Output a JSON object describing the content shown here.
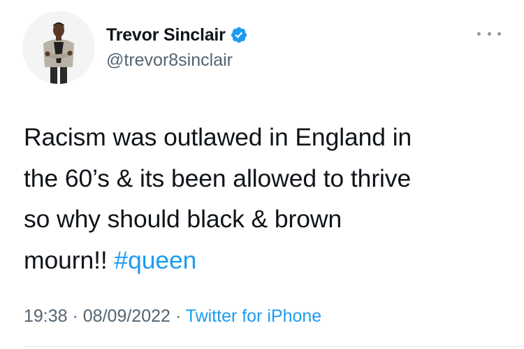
{
  "author": {
    "display_name": "Trevor Sinclair",
    "handle": "@trevor8sinclair",
    "verified": true,
    "verified_icon": "verified-badge-icon"
  },
  "tweet": {
    "lines": [
      "Racism was outlawed in England in",
      "the 60’s & its been allowed to thrive",
      "so why should black & brown",
      "mourn!! "
    ],
    "hashtag": "#queen"
  },
  "meta": {
    "time": "19:38",
    "separator": " · ",
    "date": "08/09/2022",
    "source": "Twitter for iPhone"
  },
  "icons": {
    "more": "more-options-icon"
  },
  "colors": {
    "accent": "#1d9bf0",
    "text": "#0f1419",
    "secondary": "#536471"
  }
}
